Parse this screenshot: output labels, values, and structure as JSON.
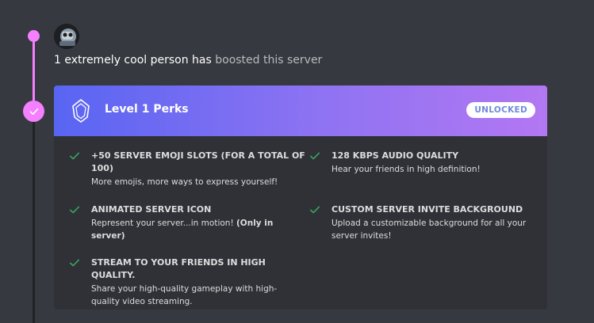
{
  "boost": {
    "who": "1 extremely cool person has",
    "rest": " boosted this server"
  },
  "level": {
    "title": "Level 1 Perks",
    "badge": "UNLOCKED"
  },
  "perks": [
    {
      "name": "+50 SERVER EMOJI SLOTS (FOR A TOTAL OF 100)",
      "desc": "More emojis, more ways to express yourself!"
    },
    {
      "name": "128 KBPS AUDIO QUALITY",
      "desc": "Hear your friends in high definition!"
    },
    {
      "name": "ANIMATED SERVER ICON",
      "desc": "Represent your server...in motion!",
      "desc_bold": "(Only in server)"
    },
    {
      "name": "CUSTOM SERVER INVITE BACKGROUND",
      "desc": "Upload a customizable background for all your server invites!"
    },
    {
      "name": "STREAM TO YOUR FRIENDS IN HIGH QUALITY.",
      "desc": "Share your high-quality gameplay with high-quality video streaming."
    }
  ],
  "colors": {
    "background": "#36393f",
    "card": "#2f3136",
    "timeline_active": "#f47fff",
    "check": "#3ba55c",
    "header_gradient_start": "#5865f2",
    "header_gradient_end": "#b377f3"
  },
  "icons": {
    "level_gem": "crystal-gem-icon",
    "node_check": "check-icon",
    "perk_check": "check-icon"
  }
}
